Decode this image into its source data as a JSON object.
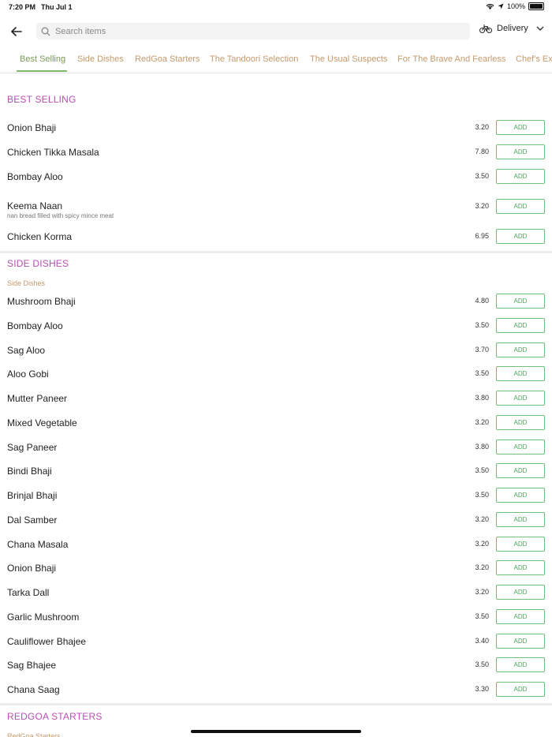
{
  "status": {
    "time": "7:20 PM",
    "date": "Thu Jul 1",
    "battery": "100%"
  },
  "search": {
    "placeholder": "Search items"
  },
  "delivery": {
    "label": "Delivery"
  },
  "tabs": [
    "Best Selling",
    "Side Dishes",
    "RedGoa Starters",
    "The Tandoori Selection",
    "The Usual Suspects",
    "For The Brave And Fearless",
    "Chef's Exc"
  ],
  "add_label": "ADD",
  "sections": {
    "best": {
      "title": "BEST SELLING",
      "items": [
        {
          "name": "Onion Bhaji",
          "price": "3.20"
        },
        {
          "name": "Chicken Tikka Masala",
          "price": "7.80"
        },
        {
          "name": "Bombay Aloo",
          "price": "3.50"
        },
        {
          "name": "Keema Naan",
          "desc": "nan bread filled with spicy mince meat",
          "price": "3.20"
        },
        {
          "name": "Chicken Korma",
          "price": "6.95"
        }
      ]
    },
    "side": {
      "title": "SIDE DISHES",
      "subtitle": "Side Dishes",
      "items": [
        {
          "name": "Mushroom Bhaji",
          "price": "4.80"
        },
        {
          "name": "Bombay Aloo",
          "price": "3.50"
        },
        {
          "name": "Sag Aloo",
          "price": "3.70"
        },
        {
          "name": "Aloo Gobi",
          "price": "3.50"
        },
        {
          "name": "Mutter Paneer",
          "price": "3.80"
        },
        {
          "name": "Mixed Vegetable",
          "price": "3.20"
        },
        {
          "name": "Sag Paneer",
          "price": "3.80"
        },
        {
          "name": "Bindi Bhaji",
          "price": "3.50"
        },
        {
          "name": "Brinjal Bhaji",
          "price": "3.50"
        },
        {
          "name": "Dal Samber",
          "price": "3.20"
        },
        {
          "name": "Chana Masala",
          "price": "3.20"
        },
        {
          "name": "Onion Bhaji",
          "price": "3.20"
        },
        {
          "name": "Tarka Dall",
          "price": "3.20"
        },
        {
          "name": "Garlic Mushroom",
          "price": "3.50"
        },
        {
          "name": "Cauliflower Bhajee",
          "price": "3.40"
        },
        {
          "name": "Sag Bhajee",
          "price": "3.50"
        },
        {
          "name": "Chana Saag",
          "price": "3.30"
        }
      ]
    },
    "starters": {
      "title": "REDGOA STARTERS",
      "subtitle": "RedGoa Starters"
    }
  },
  "colors": {
    "accent": "#48a65a",
    "section": "#b84fb4",
    "tab": "#c49a6c"
  }
}
